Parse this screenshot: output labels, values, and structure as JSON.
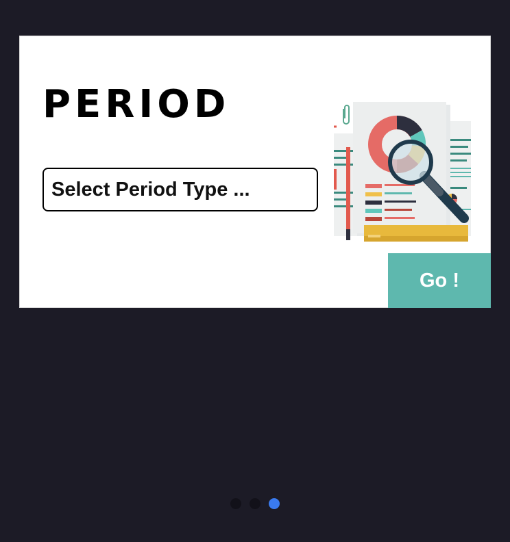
{
  "card": {
    "title": "PERIOD",
    "select": {
      "placeholder": "Select Period Type ..."
    },
    "go_label": "Go !"
  },
  "pager": {
    "total": 3,
    "active_index": 2
  },
  "colors": {
    "background": "#1c1b26",
    "card": "#ffffff",
    "go_button": "#5eb8ae",
    "active_dot": "#3a7bf0",
    "inactive_dot": "#121119"
  },
  "icons": {
    "illustration": "report-analysis-illustration"
  }
}
